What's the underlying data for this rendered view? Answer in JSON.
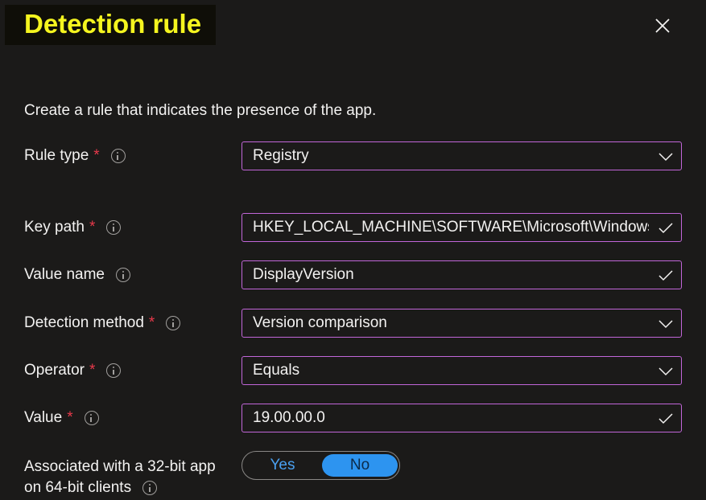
{
  "header": {
    "title": "Detection rule",
    "close_icon": "close-icon"
  },
  "description": "Create a rule that indicates the presence of the app.",
  "colors": {
    "title_highlight": "#f5f51f",
    "field_border": "#c266d9",
    "required": "#e8394b",
    "toggle_active": "#2d94f0"
  },
  "fields": {
    "rule_type": {
      "label": "Rule type",
      "required": "*",
      "value": "Registry",
      "trailing_icon": "chevron-down-icon"
    },
    "key_path": {
      "label": "Key path",
      "required": "*",
      "value": "HKEY_LOCAL_MACHINE\\SOFTWARE\\Microsoft\\Windows...",
      "trailing_icon": "checkmark-icon"
    },
    "value_name": {
      "label": "Value name",
      "value": "DisplayVersion",
      "trailing_icon": "checkmark-icon"
    },
    "detection_method": {
      "label": "Detection method",
      "required": "*",
      "value": "Version comparison",
      "trailing_icon": "chevron-down-icon"
    },
    "operator": {
      "label": "Operator",
      "required": "*",
      "value": "Equals",
      "trailing_icon": "chevron-down-icon"
    },
    "value": {
      "label": "Value",
      "required": "*",
      "value": "19.00.00.0",
      "trailing_icon": "checkmark-icon"
    }
  },
  "toggle": {
    "label_line1": "Associated with a 32-bit app",
    "label_line2": "on 64-bit clients",
    "options": [
      "Yes",
      "No"
    ],
    "selected": "No"
  }
}
